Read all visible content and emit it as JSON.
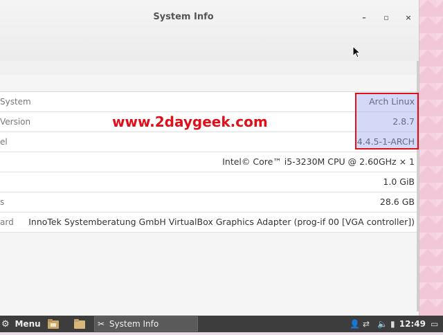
{
  "window": {
    "title": "System Info",
    "minimize_label": "–",
    "maximize_label": "▫",
    "close_label": "×"
  },
  "rows": [
    {
      "label": "System",
      "value": "Arch Linux"
    },
    {
      "label": "Version",
      "value": "2.8.7"
    },
    {
      "label": "el",
      "value": "4.4.5-1-ARCH"
    },
    {
      "label": "",
      "value": "Intel© Core™ i5-3230M CPU @ 2.60GHz × 1"
    },
    {
      "label": "",
      "value": "1.0 GiB"
    },
    {
      "label": "s",
      "value": "28.6 GB"
    },
    {
      "label": "ard",
      "value": "InnoTek Systemberatung GmbH VirtualBox Graphics Adapter (prog-if 00 [VGA controller])"
    }
  ],
  "watermark": "www.2daygeek.com",
  "taskbar": {
    "menu_label": "Menu",
    "task_label": "System Info",
    "clock": "12:49",
    "icons": [
      "settings-icon",
      "folder-icon",
      "file-manager-icon",
      "user-icon",
      "volume-icon",
      "network-icon",
      "battery-icon",
      "display-icon"
    ]
  },
  "colors": {
    "highlight_border": "#e0101a",
    "watermark": "#e0101a",
    "taskbar": "#3d3d3d",
    "desktop": "#f2c8d8"
  }
}
